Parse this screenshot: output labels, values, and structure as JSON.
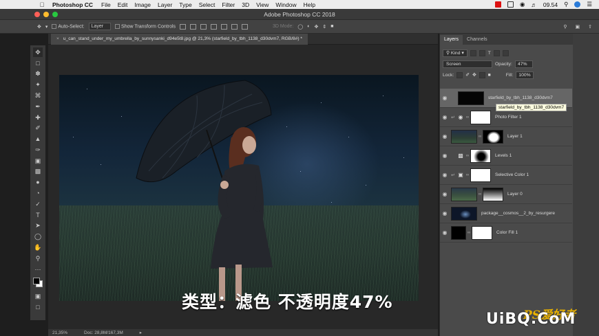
{
  "menubar": {
    "app": "Photoshop CC",
    "items": [
      "File",
      "Edit",
      "Image",
      "Layer",
      "Type",
      "Select",
      "Filter",
      "3D",
      "View",
      "Window",
      "Help"
    ],
    "clock": "09.54"
  },
  "window": {
    "title": "Adobe Photoshop CC 2018"
  },
  "options": {
    "auto_select_label": "Auto-Select:",
    "auto_select_value": "Layer",
    "transform_label": "Show Transform Controls",
    "mode_label": "3D Mode:"
  },
  "document": {
    "tab_label": "u_can_stand_under_my_umbrella_by_sunnysanki_d94e5t8.jpg @ 21,3% (starfield_by_tbh_1138_d30dvm7, RGB/8#) *",
    "zoom": "21,35%",
    "doc_size": "Doc: 28,8M/167,3M",
    "overlay_text": "类型：滤色  不透明度47%"
  },
  "panel": {
    "tabs": [
      "Layers",
      "Channels"
    ],
    "filter_label": "Kind",
    "blend_mode": "Screen",
    "opacity_label": "Opacity:",
    "opacity_value": "47%",
    "lock_label": "Lock:",
    "fill_label": "Fill:",
    "fill_value": "100%",
    "tooltip": "starfield_by_tbh_1138_d30dvm7",
    "layers": [
      {
        "name": "starfield_by_tbh_1138_d30dvm7",
        "selected": true
      },
      {
        "name": "Photo Filter 1"
      },
      {
        "name": "Layer 1"
      },
      {
        "name": "Levels 1"
      },
      {
        "name": "Selective Color 1"
      },
      {
        "name": "Layer 0"
      },
      {
        "name": "package__cosmos__2_by_resurgere"
      },
      {
        "name": "Color Fill 1"
      }
    ]
  },
  "watermark": {
    "latin": "UiBQ.CoM",
    "cn": "PS爱好者"
  },
  "colors": {
    "panel_bg": "#4a4a4a",
    "selected_layer": "#666666",
    "canvas_bg": "#282828"
  }
}
